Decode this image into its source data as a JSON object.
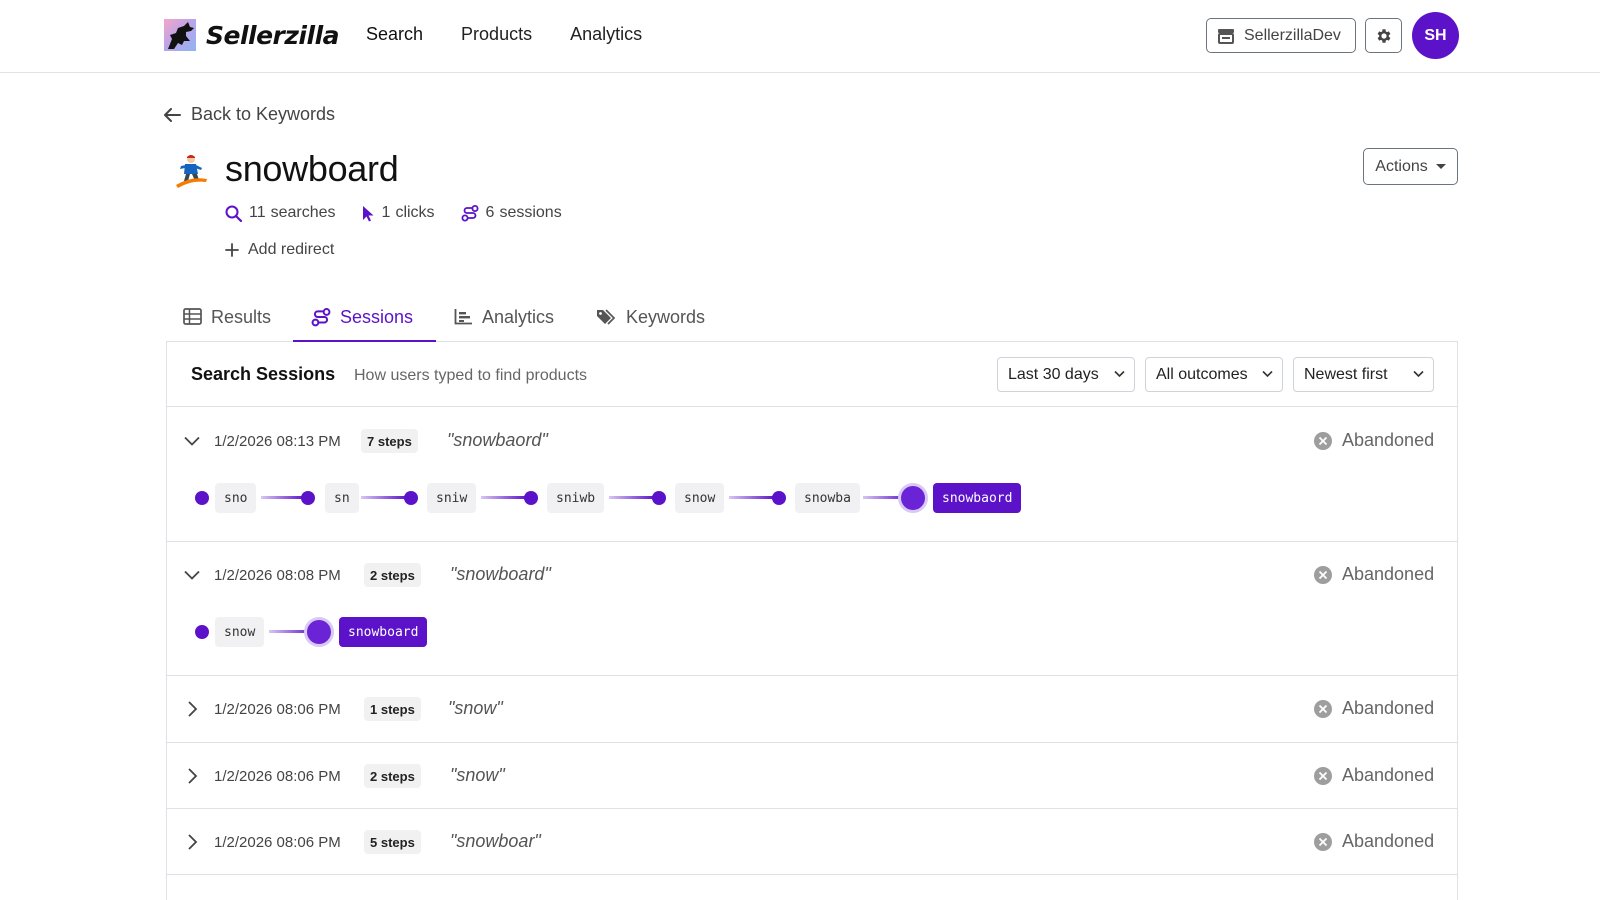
{
  "nav": {
    "brand": "Sellerzilla",
    "links": [
      "Search",
      "Products",
      "Analytics"
    ],
    "store": "SellerzillaDev",
    "avatar_initials": "SH"
  },
  "header": {
    "back_label": "Back to Keywords",
    "keyword": "snowboard",
    "stats": {
      "searches_count": "11",
      "searches_label": "searches",
      "clicks_count": "1",
      "clicks_label": "clicks",
      "sessions_count": "6",
      "sessions_label": "sessions"
    },
    "add_redirect": "Add redirect",
    "actions_label": "Actions"
  },
  "tabs": [
    "Results",
    "Sessions",
    "Analytics",
    "Keywords"
  ],
  "active_tab": "Sessions",
  "card": {
    "title": "Search Sessions",
    "subtitle": "How users typed to find products",
    "filters": {
      "date_range": "Last 30 days",
      "outcome": "All outcomes",
      "sort": "Newest first"
    }
  },
  "sessions": [
    {
      "date": "1/2/2026 08:13 PM",
      "steps": "7 steps",
      "query": "\"snowbaord\"",
      "outcome": "Abandoned",
      "expanded": true,
      "chips": [
        "sno",
        "sn",
        "sniw",
        "sniwb",
        "snow",
        "snowba",
        "snowbaord"
      ]
    },
    {
      "date": "1/2/2026 08:08 PM",
      "steps": "2 steps",
      "query": "\"snowboard\"",
      "outcome": "Abandoned",
      "expanded": true,
      "chips": [
        "snow",
        "snowboard"
      ]
    },
    {
      "date": "1/2/2026 08:06 PM",
      "steps": "1 steps",
      "query": "\"snow\"",
      "outcome": "Abandoned",
      "expanded": false
    },
    {
      "date": "1/2/2026 08:06 PM",
      "steps": "2 steps",
      "query": "\"snow\"",
      "outcome": "Abandoned",
      "expanded": false
    },
    {
      "date": "1/2/2026 08:06 PM",
      "steps": "5 steps",
      "query": "\"snowboar\"",
      "outcome": "Abandoned",
      "expanded": false
    }
  ],
  "colors": {
    "accent": "#5b12c9",
    "accent_light": "#d9c9f5",
    "border": "#dee2e6"
  }
}
